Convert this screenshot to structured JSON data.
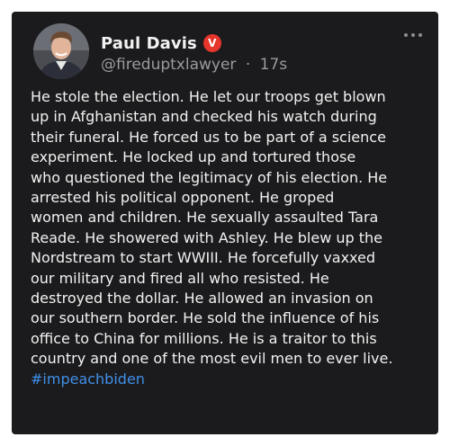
{
  "post": {
    "author": {
      "display_name": "Paul Davis",
      "badge_icon": "v-badge-icon",
      "badge_letter": "V",
      "badge_color": "#e6352b",
      "handle": "@fireduptxlawyer",
      "separator": "·",
      "time": "17s"
    },
    "more_icon": "more-options-icon",
    "body_lines": [
      "He stole the election. He let our troops get blown",
      "up in Afghanistan and checked his watch during",
      "their funeral. He forced us to be part of a science",
      "experiment. He locked up and tortured those",
      "who questioned the legitimacy of his election. He",
      "arrested his political opponent. He groped",
      "women and children. He sexually assaulted Tara",
      "Reade. He showered with Ashley. He blew up the",
      "Nordstream to start WWIII. He forcefully vaxxed",
      "our military and fired all who resisted. He",
      "destroyed the dollar. He allowed an invasion on",
      "our southern border. He sold the influence of his",
      "office to China for millions. He is a traitor to this",
      "country and one of the most evil men to ever live."
    ],
    "hashtag": "#impeachbiden",
    "hashtag_color": "#3f8fe8"
  }
}
